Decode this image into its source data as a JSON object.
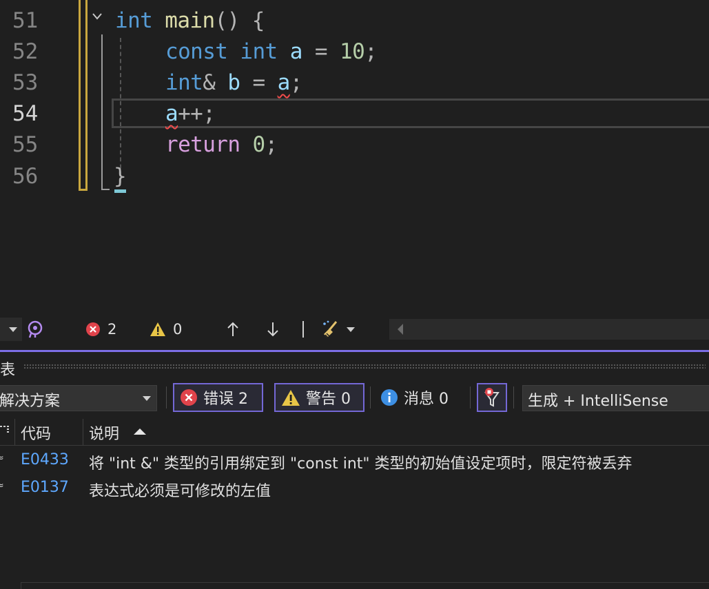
{
  "editor": {
    "lines": [
      {
        "number": "51"
      },
      {
        "number": "52"
      },
      {
        "number": "53"
      },
      {
        "number": "54"
      },
      {
        "number": "55"
      },
      {
        "number": "56"
      }
    ],
    "tokens": {
      "l51_int": "int",
      "l51_main": "main",
      "l51_parens": "()",
      "l51_brace": "{",
      "l52_const": "const",
      "l52_int": "int",
      "l52_a": "a",
      "l52_eq": "=",
      "l52_num": "10",
      "l52_semi": ";",
      "l53_int": "int",
      "l53_amp": "&",
      "l53_b": "b",
      "l53_eq": "=",
      "l53_a": "a",
      "l53_semi": ";",
      "l54_a": "a",
      "l54_pp": "++;",
      "l55_return": "return",
      "l55_num": "0",
      "l55_semi": ";",
      "l56_brace": "}"
    }
  },
  "toolbar": {
    "error_count": "2",
    "warning_count": "0"
  },
  "panel": {
    "title": "表",
    "scope": "解决方案",
    "filters": {
      "errors": "错误 2",
      "warnings": "警告 0",
      "messages": "消息 0"
    },
    "source": "生成 + IntelliSense",
    "columns": {
      "code": "代码",
      "description": "说明"
    },
    "rows": [
      {
        "code": "E0433",
        "description": "将 \"int &\" 类型的引用绑定到 \"const int\" 类型的初始值设定项时，限定符被丢弃"
      },
      {
        "code": "E0137",
        "description": "表达式必须是可修改的左值"
      }
    ]
  },
  "colors": {
    "accent": "#7c6ee6",
    "error": "#e0434b",
    "warning": "#e8c547",
    "info": "#3d8fe3",
    "link": "#5ea8ff"
  }
}
